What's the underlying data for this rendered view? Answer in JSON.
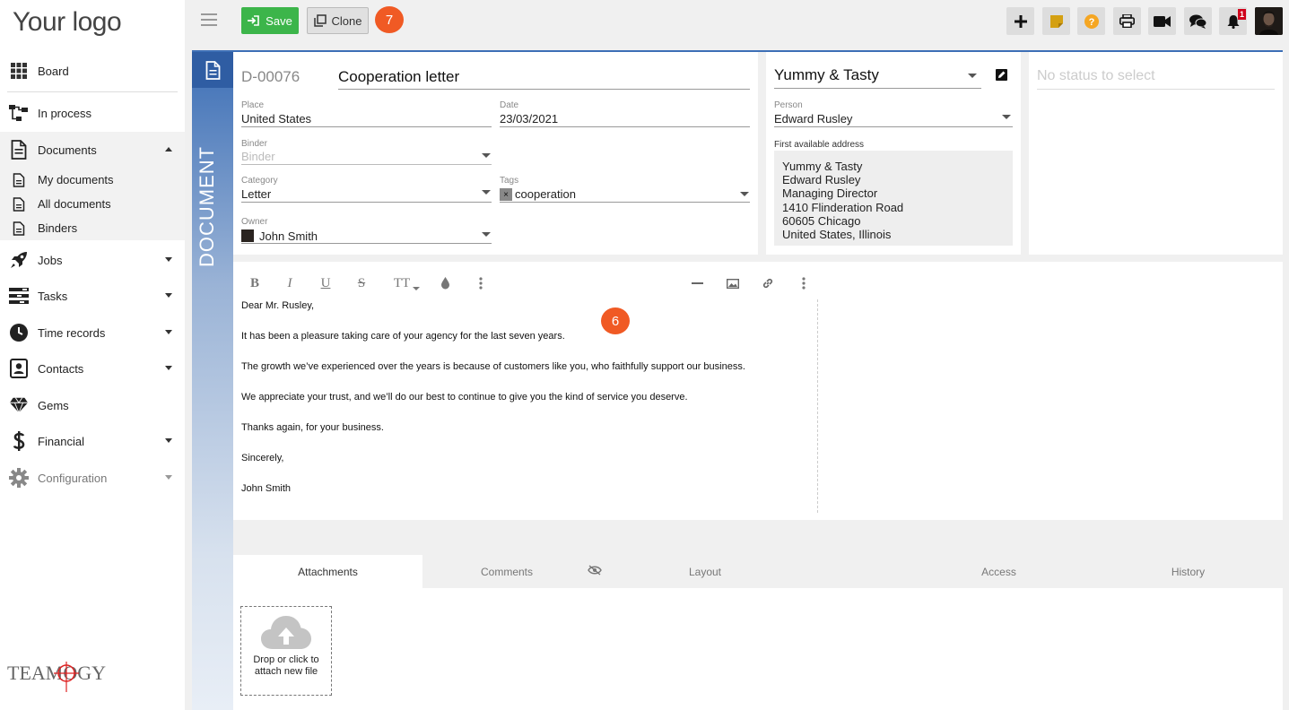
{
  "app": {
    "logo_text": "Your logo",
    "brand_text": "TEAMOGY"
  },
  "sidebar": {
    "items": [
      {
        "label": "Board",
        "icon": "grid-icon"
      },
      {
        "label": "In process",
        "icon": "workflow-icon"
      },
      {
        "label": "Documents",
        "icon": "document-icon"
      },
      {
        "label": "Jobs",
        "icon": "rocket-icon"
      },
      {
        "label": "Tasks",
        "icon": "tasks-icon"
      },
      {
        "label": "Time records",
        "icon": "clock-icon"
      },
      {
        "label": "Contacts",
        "icon": "contacts-icon"
      },
      {
        "label": "Gems",
        "icon": "diamond-icon"
      },
      {
        "label": "Financial",
        "icon": "dollar-icon"
      },
      {
        "label": "Configuration",
        "icon": "gear-icon"
      }
    ],
    "sub_items": [
      {
        "label": "My documents"
      },
      {
        "label": "All documents"
      },
      {
        "label": "Binders"
      }
    ]
  },
  "toolbar": {
    "save_label": "Save",
    "clone_label": "Clone",
    "marker_7": "7",
    "notification_count": "1",
    "accent_save": "#3cb54a",
    "marker_color": "#f05a24"
  },
  "document": {
    "side_label": "DOCUMENT",
    "number": "D-00076",
    "title": "Cooperation letter",
    "place_label": "Place",
    "place_value": "United States",
    "date_label": "Date",
    "date_value": "23/03/2021",
    "binder_label": "Binder",
    "binder_placeholder": "Binder",
    "category_label": "Category",
    "category_value": "Letter",
    "tags_label": "Tags",
    "tag_value": "cooperation",
    "owner_label": "Owner",
    "owner_value": "John Smith"
  },
  "company": {
    "name": "Yummy & Tasty",
    "person_label": "Person",
    "person_value": "Edward Rusley",
    "address_label": "First available address",
    "address_lines": [
      "Yummy & Tasty",
      "Edward Rusley",
      "Managing Director",
      "1410 Flinderation Road",
      "60605 Chicago",
      "United States, Illinois"
    ]
  },
  "status": {
    "placeholder": "No status to select"
  },
  "editor": {
    "marker_6": "6",
    "tools": [
      "B",
      "I",
      "U",
      "S",
      "TT"
    ],
    "lines": [
      "Dear Mr. Rusley,",
      "It has been a pleasure taking care of your agency for the last seven years.",
      "The growth we’ve experienced over the years is because of customers like you, who faithfully support our business.",
      "We appreciate your trust, and we’ll do our best to continue to give you the kind of service you deserve.",
      "Thanks again, for your business.",
      "Sincerely,",
      "John Smith"
    ]
  },
  "tabs": [
    {
      "label": "Attachments"
    },
    {
      "label": "Comments"
    },
    {
      "label": "Layout"
    },
    {
      "label": "Access"
    },
    {
      "label": "History"
    }
  ],
  "attachments": {
    "drop_line1": "Drop or click to",
    "drop_line2": "attach new file"
  }
}
